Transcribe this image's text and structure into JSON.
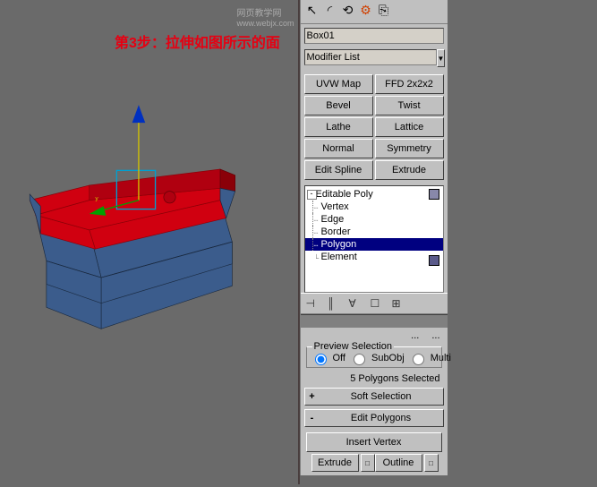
{
  "annotation": "第3步：拉伸如图所示的面",
  "watermark": "网页教学网",
  "watermark_url": "www.webjx.com",
  "toolbar_icons": [
    "cursor-icon",
    "arc-icon",
    "rotate-icon",
    "scale-icon",
    "link-icon"
  ],
  "object_name": "Box01",
  "modifier_list_label": "Modifier List",
  "modifier_buttons": [
    "UVW Map",
    "FFD 2x2x2",
    "Bevel",
    "Twist",
    "Lathe",
    "Lattice",
    "Normal",
    "Symmetry",
    "Edit Spline",
    "Extrude"
  ],
  "stack": {
    "top": "Editable Poly",
    "sub": [
      "Vertex",
      "Edge",
      "Border",
      "Polygon",
      "Element"
    ],
    "selected": "Polygon"
  },
  "truncated": {
    "a": "...",
    "b": "..."
  },
  "preview": {
    "title": "Preview Selection",
    "options": [
      "Off",
      "SubObj",
      "Multi"
    ],
    "selected": "Off"
  },
  "status": "5 Polygons Selected",
  "rollouts": {
    "soft": {
      "sign": "+",
      "label": "Soft Selection"
    },
    "edit": {
      "sign": "-",
      "label": "Edit Polygons"
    }
  },
  "edit_poly": {
    "insert_vertex": "Insert Vertex",
    "extrude": "Extrude",
    "outline": "Outline",
    "sp": "□"
  }
}
